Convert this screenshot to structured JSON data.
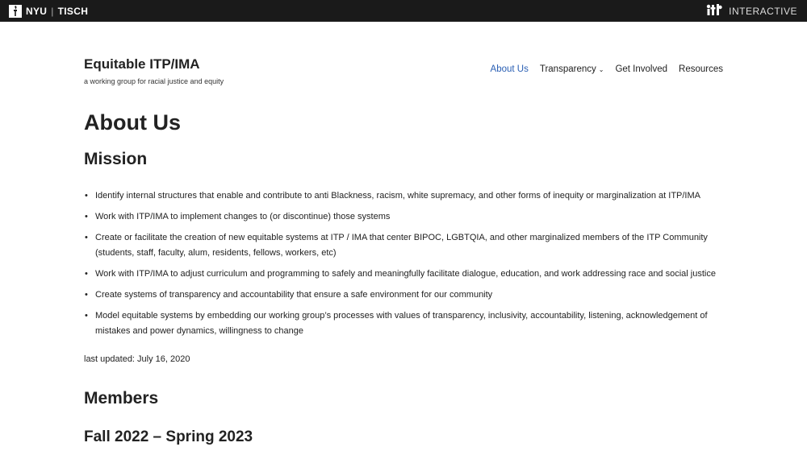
{
  "topbar": {
    "nyu": "NYU",
    "tisch": "TISCH",
    "interactive": "INTERACTIVE",
    "nyu_logo_icon": "torch-icon",
    "itp_logo_icon": "itp-logo-icon"
  },
  "site": {
    "title": "Equitable ITP/IMA",
    "tagline": "a working group for racial justice and equity"
  },
  "nav": {
    "items": [
      {
        "label": "About Us",
        "active": true
      },
      {
        "label": "Transparency",
        "dropdown": true
      },
      {
        "label": "Get Involved"
      },
      {
        "label": "Resources"
      }
    ],
    "accent_color": "#2a5fb4"
  },
  "page": {
    "title": "About Us",
    "mission_heading": "Mission",
    "mission_items": [
      "Identify internal structures that enable and contribute to anti Blackness, racism, white supremacy, and other forms of inequity or marginalization at ITP/IMA",
      "Work with ITP/IMA to implement changes to (or discontinue) those systems",
      "Create or facilitate the creation of new equitable systems at ITP / IMA that center BIPOC, LGBTQIA, and other marginalized members of the ITP Community (students, staff, faculty, alum, residents, fellows, workers, etc)",
      "Work with ITP/IMA to adjust curriculum and programming to safely and meaningfully facilitate dialogue, education, and work addressing race and social justice",
      "Create systems of transparency and accountability that ensure a safe environment for our community",
      "Model equitable systems by embedding our working group’s processes with values of transparency, inclusivity, accountability, listening, acknowledgement of mistakes and power dynamics, willingness to change"
    ],
    "last_updated": "last updated: July 16, 2020",
    "members_heading": "Members",
    "term_heading": "Fall 2022 – Spring 2023"
  }
}
